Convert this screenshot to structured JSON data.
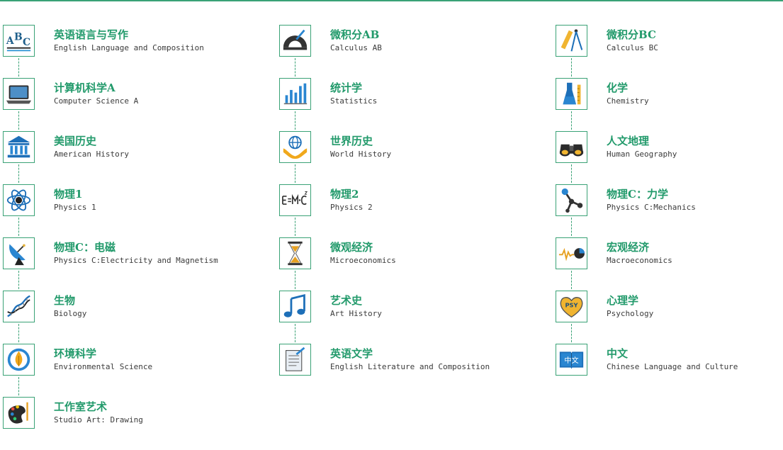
{
  "accent_color": "#3aa276",
  "columns": [
    {
      "items": [
        {
          "icon": "abc-letters-icon",
          "title_zh": "英语语言与写作",
          "title_en": "English Language and Composition"
        },
        {
          "icon": "laptop-icon",
          "title_zh": "计算机科学A",
          "title_en": "Computer Science A"
        },
        {
          "icon": "capitol-building-icon",
          "title_zh": "美国历史",
          "title_en": "American History"
        },
        {
          "icon": "atom-icon",
          "title_zh": "物理1",
          "title_en": "Physics 1"
        },
        {
          "icon": "satellite-dish-icon",
          "title_zh": "物理C：电磁",
          "title_en": "Physics C:Electricity and Magnetism"
        },
        {
          "icon": "dna-icon",
          "title_zh": "生物",
          "title_en": "Biology"
        },
        {
          "icon": "leaf-drop-icon",
          "title_zh": "环境科学",
          "title_en": "Environmental Science"
        },
        {
          "icon": "paint-palette-icon",
          "title_zh": "工作室艺术",
          "title_en": "Studio Art: Drawing"
        }
      ]
    },
    {
      "items": [
        {
          "icon": "protractor-icon",
          "title_zh": "微积分AB",
          "title_en": "Calculus AB"
        },
        {
          "icon": "bar-chart-icon",
          "title_zh": "统计学",
          "title_en": "Statistics"
        },
        {
          "icon": "globe-hands-icon",
          "title_zh": "世界历史",
          "title_en": "World History"
        },
        {
          "icon": "emc2-formula-icon",
          "title_zh": "物理2",
          "title_en": "Physics 2"
        },
        {
          "icon": "hourglass-icon",
          "title_zh": "微观经济",
          "title_en": "Microeconomics"
        },
        {
          "icon": "music-note-icon",
          "title_zh": "艺术史",
          "title_en": "Art History"
        },
        {
          "icon": "document-pen-icon",
          "title_zh": "英语文学",
          "title_en": "English Literature and Composition"
        }
      ]
    },
    {
      "items": [
        {
          "icon": "compass-ruler-icon",
          "title_zh": "微积分BC",
          "title_en": "Calculus BC"
        },
        {
          "icon": "flask-icon",
          "title_zh": "化学",
          "title_en": "Chemistry"
        },
        {
          "icon": "binoculars-icon",
          "title_zh": "人文地理",
          "title_en": "Human Geography"
        },
        {
          "icon": "molecule-icon",
          "title_zh": "物理C：力学",
          "title_en": "Physics C:Mechanics"
        },
        {
          "icon": "pulse-pie-icon",
          "title_zh": "宏观经济",
          "title_en": "Macroeconomics"
        },
        {
          "icon": "psy-heart-icon",
          "icon_text": "PSY",
          "title_zh": "心理学",
          "title_en": "Psychology"
        },
        {
          "icon": "chinese-book-icon",
          "icon_text": "中文",
          "title_zh": "中文",
          "title_en": "Chinese Language and Culture"
        }
      ]
    }
  ]
}
